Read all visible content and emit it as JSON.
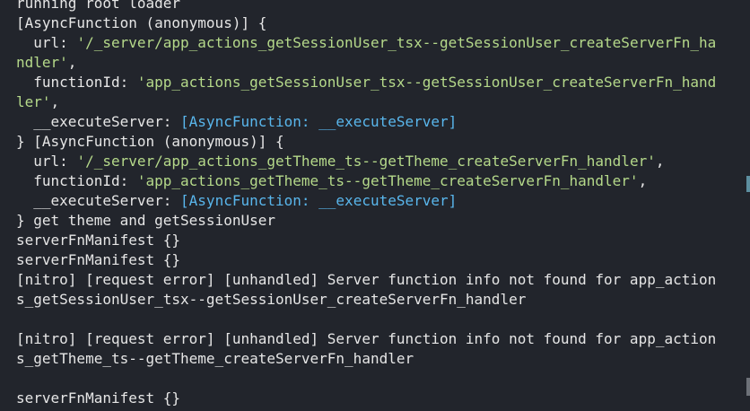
{
  "terminal": {
    "lines": [
      [
        {
          "text": "running root loader",
          "style": "plain"
        }
      ],
      [
        {
          "text": "[AsyncFunction (anonymous)] {",
          "style": "plain"
        }
      ],
      [
        {
          "text": "  url: ",
          "style": "plain"
        },
        {
          "text": "'/_server/app_actions_getSessionUser_tsx--getSessionUser_createServerFn_ha",
          "style": "str"
        }
      ],
      [
        {
          "text": "ndler'",
          "style": "str"
        },
        {
          "text": ",",
          "style": "plain"
        }
      ],
      [
        {
          "text": "  functionId: ",
          "style": "plain"
        },
        {
          "text": "'app_actions_getSessionUser_tsx--getSessionUser_createServerFn_hand",
          "style": "str"
        }
      ],
      [
        {
          "text": "ler'",
          "style": "str"
        },
        {
          "text": ",",
          "style": "plain"
        }
      ],
      [
        {
          "text": "  __executeServer: ",
          "style": "plain"
        },
        {
          "text": "[AsyncFunction: __executeServer]",
          "style": "fn"
        }
      ],
      [
        {
          "text": "} [AsyncFunction (anonymous)] {",
          "style": "plain"
        }
      ],
      [
        {
          "text": "  url: ",
          "style": "plain"
        },
        {
          "text": "'/_server/app_actions_getTheme_ts--getTheme_createServerFn_handler'",
          "style": "str"
        },
        {
          "text": ",",
          "style": "plain"
        }
      ],
      [
        {
          "text": "  functionId: ",
          "style": "plain"
        },
        {
          "text": "'app_actions_getTheme_ts--getTheme_createServerFn_handler'",
          "style": "str"
        },
        {
          "text": ",",
          "style": "plain"
        }
      ],
      [
        {
          "text": "  __executeServer: ",
          "style": "plain"
        },
        {
          "text": "[AsyncFunction: __executeServer]",
          "style": "fn"
        }
      ],
      [
        {
          "text": "} get theme and getSessionUser",
          "style": "plain"
        }
      ],
      [
        {
          "text": "serverFnManifest {}",
          "style": "plain"
        }
      ],
      [
        {
          "text": "serverFnManifest {}",
          "style": "plain"
        }
      ],
      [
        {
          "text": "[nitro] [request error] [unhandled] Server function info not found for app_action",
          "style": "plain"
        }
      ],
      [
        {
          "text": "s_getSessionUser_tsx--getSessionUser_createServerFn_handler",
          "style": "plain"
        }
      ],
      [
        {
          "text": "",
          "style": "plain"
        }
      ],
      [
        {
          "text": "[nitro] [request error] [unhandled] Server function info not found for app_action",
          "style": "plain"
        }
      ],
      [
        {
          "text": "s_getTheme_ts--getTheme_createServerFn_handler",
          "style": "plain"
        }
      ],
      [
        {
          "text": "",
          "style": "plain"
        }
      ],
      [
        {
          "text": "serverFnManifest {}",
          "style": "plain"
        }
      ]
    ]
  }
}
